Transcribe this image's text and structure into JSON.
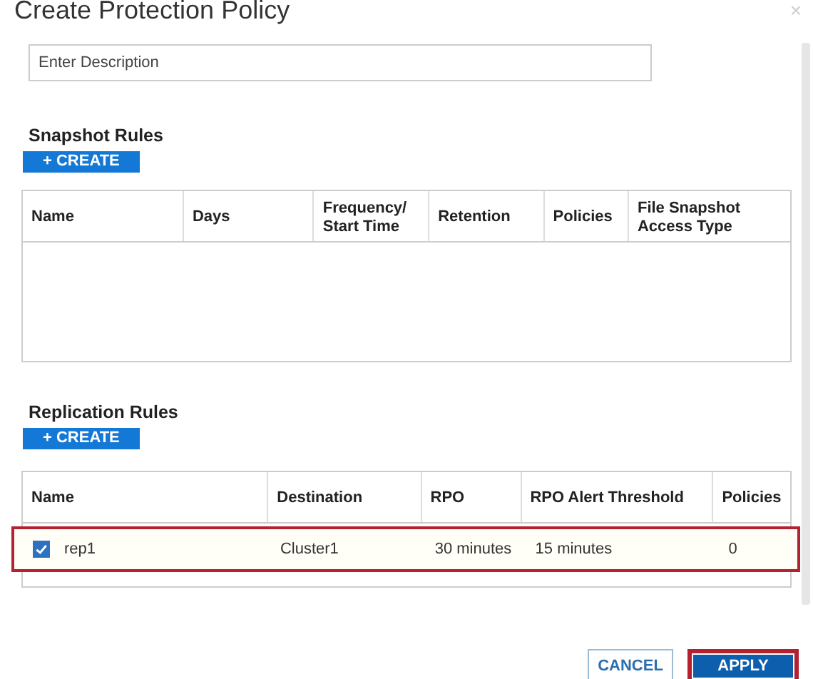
{
  "dialog": {
    "title": "Create Protection Policy",
    "close": "×"
  },
  "description": {
    "placeholder": "Enter Description"
  },
  "snapshot_rules": {
    "heading": "Snapshot Rules",
    "create_button": "+ CREATE",
    "columns": [
      "Name",
      "Days",
      "Frequency/ Start Time",
      "Retention",
      "Policies",
      "File Snapshot Access Type"
    ]
  },
  "replication_rules": {
    "heading": "Replication Rules",
    "create_button": "+ CREATE",
    "columns": [
      "Name",
      "Destination",
      "RPO",
      "RPO Alert Threshold",
      "Policies"
    ],
    "rows": [
      {
        "checked": true,
        "highlighted": true,
        "cells": [
          "rep1",
          "Cluster1",
          "30 minutes",
          "15 minutes",
          "0"
        ]
      }
    ]
  },
  "buttons": [
    {
      "label": "CANCEL",
      "kind": "secondary",
      "highlighted": false
    },
    {
      "label": "APPLY",
      "kind": "primary",
      "highlighted": true
    }
  ]
}
